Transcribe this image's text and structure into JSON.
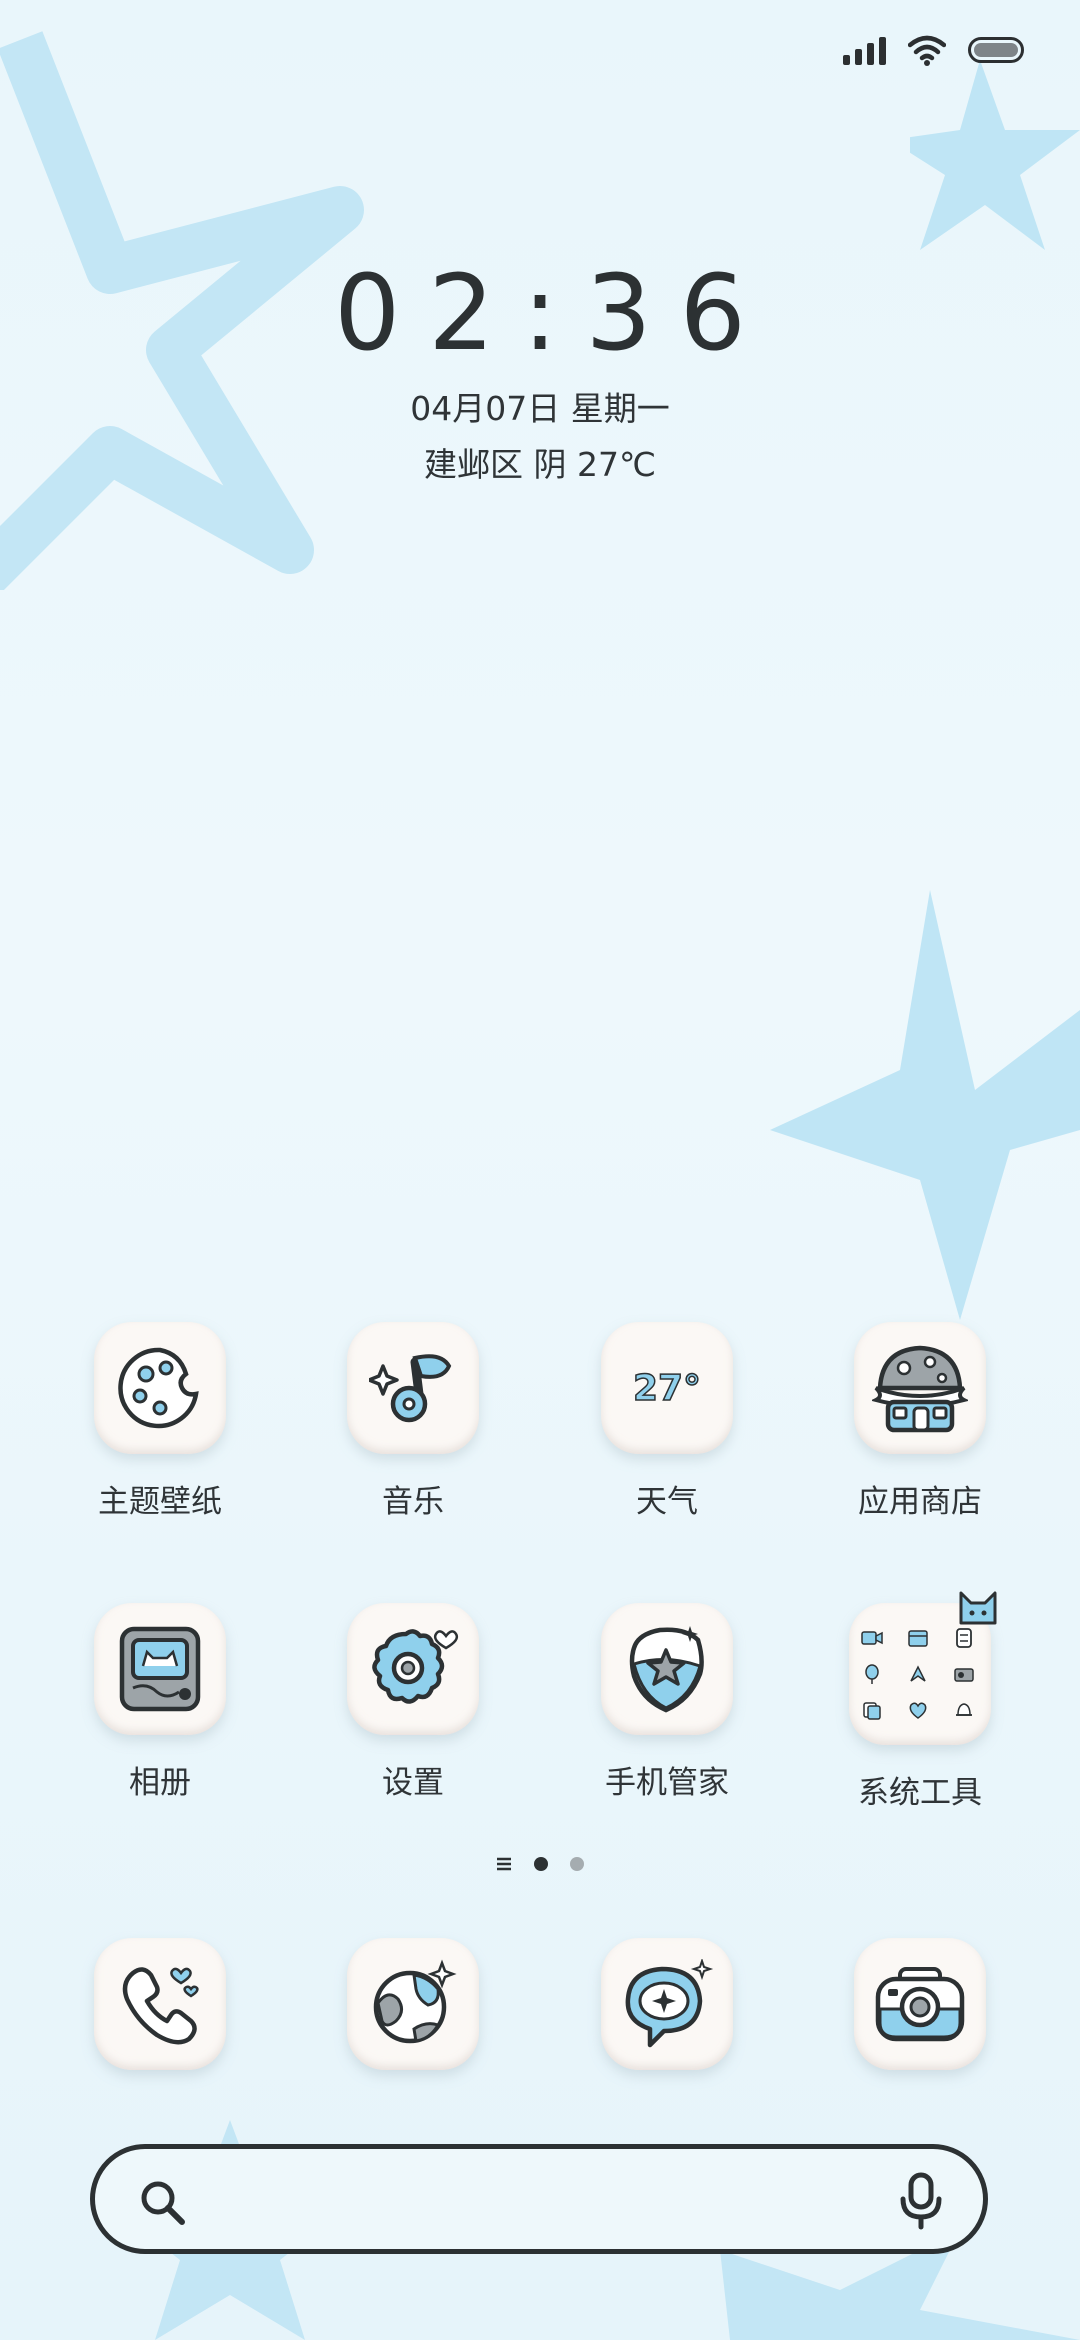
{
  "status_bar": {
    "icons": [
      "signal-icon",
      "wifi-icon",
      "battery-icon"
    ]
  },
  "lock": {
    "time": "02:36",
    "date": "04月07日 星期一",
    "weather": "建邺区 阴 27℃"
  },
  "apps_row1": [
    {
      "label": "主题壁纸",
      "icon": "palette-icon"
    },
    {
      "label": "音乐",
      "icon": "music-note-icon"
    },
    {
      "label": "天气",
      "icon": "weather-icon",
      "icon_text": "27°"
    },
    {
      "label": "应用商店",
      "icon": "mushroom-house-icon"
    }
  ],
  "apps_row2": [
    {
      "label": "相册",
      "icon": "photo-frame-icon"
    },
    {
      "label": "设置",
      "icon": "gear-icon"
    },
    {
      "label": "手机管家",
      "icon": "shield-star-icon"
    },
    {
      "label": "系统工具",
      "icon": "folder-icon"
    }
  ],
  "dock": [
    {
      "icon": "phone-icon"
    },
    {
      "icon": "browser-globe-icon"
    },
    {
      "icon": "message-bubble-icon"
    },
    {
      "icon": "camera-icon"
    }
  ],
  "page_indicator": {
    "pages": 2,
    "active": 1
  },
  "search": {
    "icons": [
      "search-icon",
      "microphone-icon"
    ]
  },
  "colors": {
    "accent": "#8fd0ec",
    "outline": "#2c3133",
    "star": "#b8e2f4"
  }
}
